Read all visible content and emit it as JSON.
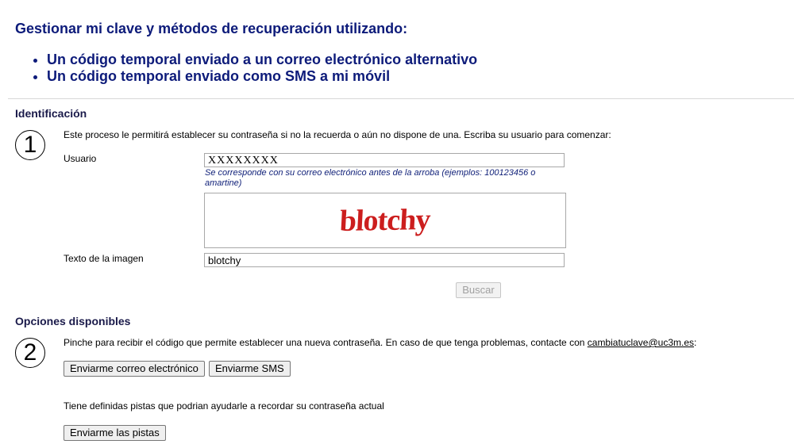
{
  "header": {
    "title": "Gestionar mi clave y métodos de recuperación utilizando:",
    "bullets": [
      "Un código temporal enviado a un correo electrónico alternativo",
      "Un código temporal enviado como SMS a mi móvil"
    ]
  },
  "identificacion": {
    "title": "Identificación",
    "step": "1",
    "intro": "Este proceso le permitirá establecer su contraseña si no la recuerda o aún no dispone de una. Escriba su usuario para comenzar:",
    "user_label": "Usuario",
    "user_value": "XXXXXXXX",
    "user_hint": "Se corresponde con su correo electrónico antes de la arroba (ejemplos: 100123456 o amartine)",
    "captcha_word": "blotchy",
    "captcha_label": "Texto de la imagen",
    "captcha_value": "blotchy",
    "search_button": "Buscar"
  },
  "opciones": {
    "title": "Opciones disponibles",
    "step": "2",
    "intro_text": "Pinche para recibir el código que permite establecer una nueva contraseña. En caso de que tenga problemas, contacte con",
    "contact_email": "cambiatuclave@uc3m.es",
    "intro_suffix": ":",
    "email_button": "Enviarme correo electrónico",
    "sms_button": "Enviarme SMS",
    "hints_text": "Tiene definidas pistas que podrian ayudarle a recordar su contraseña actual",
    "hints_button": "Enviarme las pistas"
  },
  "colors": {
    "heading": "#0d1b7a",
    "captcha": "#cc1e1e"
  }
}
